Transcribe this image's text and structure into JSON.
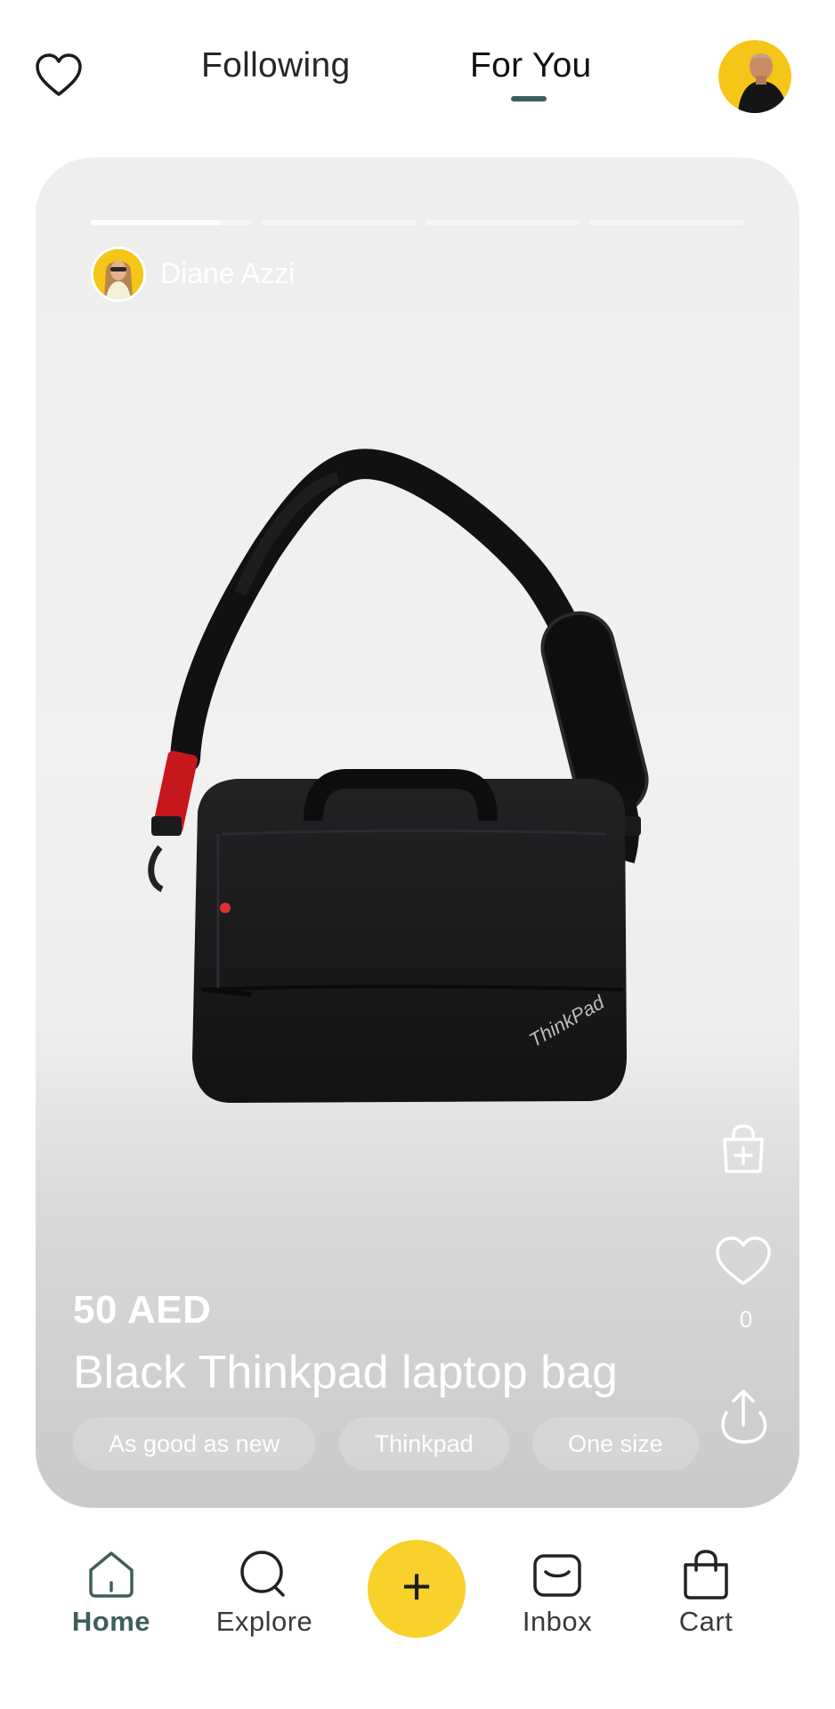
{
  "header": {
    "tabs": [
      {
        "label": "Following",
        "active": false
      },
      {
        "label": "For You",
        "active": true
      }
    ],
    "icons": {
      "favorites": "heart-outline-icon",
      "profile": "user-avatar"
    }
  },
  "post": {
    "seller_name": "Diane Azzi",
    "story_progress": {
      "segments": 4,
      "current": 1,
      "current_fraction": 0.8
    },
    "price": "50 AED",
    "title": "Black Thinkpad laptop bag",
    "tags": [
      "As good as new",
      "Thinkpad",
      "One size"
    ],
    "like_count": "0",
    "bag_brand_text": "ThinkPad",
    "actions": [
      "add-to-bag-icon",
      "heart-icon",
      "share-icon"
    ]
  },
  "nav": {
    "items": [
      {
        "label": "Home",
        "icon": "home-icon",
        "active": true
      },
      {
        "label": "Explore",
        "icon": "search-icon",
        "active": false
      },
      {
        "label": "+",
        "icon": "plus-icon",
        "active": false
      },
      {
        "label": "Inbox",
        "icon": "inbox-icon",
        "active": false
      },
      {
        "label": "Cart",
        "icon": "shopping-bag-icon",
        "active": false
      }
    ]
  },
  "colors": {
    "accent": "#3d5f5b",
    "fab": "#f8d22b",
    "avatar_bg": "#f5c518"
  }
}
